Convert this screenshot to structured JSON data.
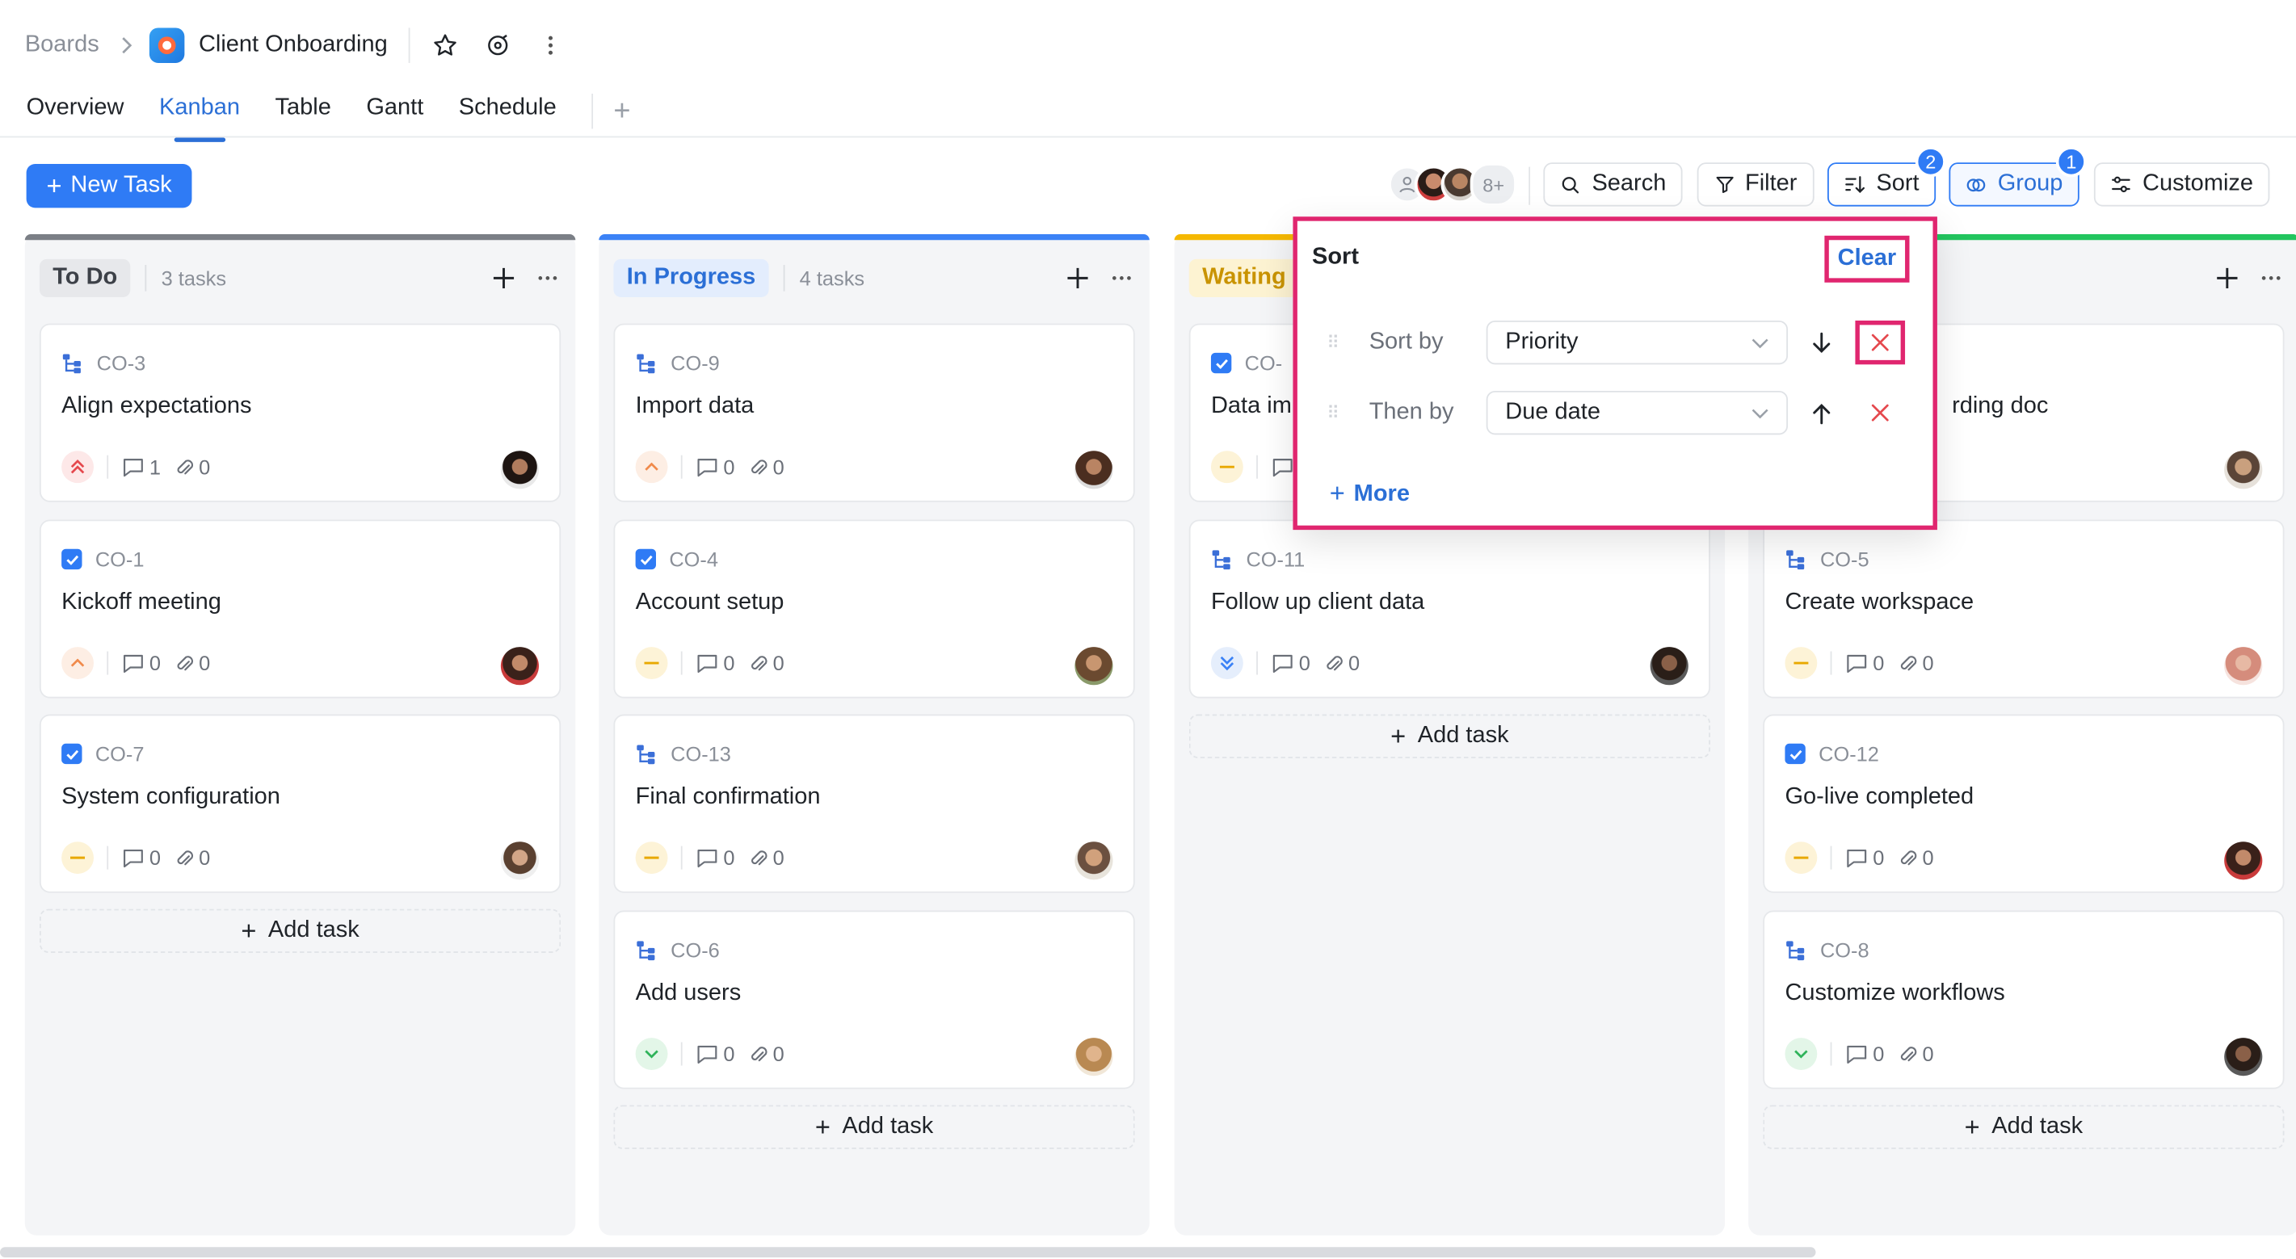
{
  "breadcrumb": {
    "root": "Boards",
    "board_title": "Client Onboarding"
  },
  "tabs": [
    "Overview",
    "Kanban",
    "Table",
    "Gantt",
    "Schedule"
  ],
  "active_tab": "Kanban",
  "toolbar": {
    "new_task": "New Task",
    "members_more": "8+",
    "search": "Search",
    "filter": "Filter",
    "sort": "Sort",
    "sort_badge": "2",
    "group": "Group",
    "group_badge": "1",
    "customize": "Customize"
  },
  "colors": {
    "accent": "#2f7bf5",
    "highlight": "#e0266f",
    "todo": "#7b7f86",
    "in_progress": "#3b82f6",
    "waiting": "#f5b800",
    "done": "#22c55e"
  },
  "columns": [
    {
      "name": "To Do",
      "count": "3 tasks",
      "add_task": "Add task",
      "cards": [
        {
          "id": "CO-3",
          "title": "Align expectations",
          "type": "subtask",
          "priority": "urgent",
          "comments": "1",
          "attachments": "0",
          "avatar": "avatar-woman-dark-hair"
        },
        {
          "id": "CO-1",
          "title": "Kickoff meeting",
          "type": "task",
          "priority": "high",
          "comments": "0",
          "attachments": "0",
          "avatar": "avatar-woman-red-top"
        },
        {
          "id": "CO-7",
          "title": "System configuration",
          "type": "task",
          "priority": "medium",
          "comments": "0",
          "attachments": "0",
          "avatar": "avatar-man-light"
        }
      ]
    },
    {
      "name": "In Progress",
      "count": "4 tasks",
      "add_task": "Add task",
      "cards": [
        {
          "id": "CO-9",
          "title": "Import data",
          "type": "subtask",
          "priority": "high",
          "comments": "0",
          "attachments": "0",
          "avatar": "avatar-woman-curly"
        },
        {
          "id": "CO-4",
          "title": "Account setup",
          "type": "task",
          "priority": "medium",
          "comments": "0",
          "attachments": "0",
          "avatar": "avatar-woman-glasses"
        },
        {
          "id": "CO-13",
          "title": "Final confirmation",
          "type": "subtask",
          "priority": "medium",
          "comments": "0",
          "attachments": "0",
          "avatar": "avatar-man-smiling"
        },
        {
          "id": "CO-6",
          "title": "Add users",
          "type": "subtask",
          "priority": "low",
          "comments": "0",
          "attachments": "0",
          "avatar": "avatar-woman-blonde"
        }
      ]
    },
    {
      "name": "Waiting",
      "count": "",
      "add_task": "Add task",
      "cards": [
        {
          "id": "CO-",
          "title": "Data im",
          "type": "task",
          "priority": "medium",
          "comments": "",
          "attachments": "",
          "avatar": ""
        },
        {
          "id": "CO-11",
          "title": "Follow up client data",
          "type": "subtask",
          "priority": "lowest",
          "comments": "0",
          "attachments": "0",
          "avatar": "avatar-man-dark"
        }
      ]
    },
    {
      "name": "",
      "count": "",
      "add_task": "Add task",
      "cards": [
        {
          "id": "",
          "title": "rding doc",
          "type": "",
          "priority": "",
          "comments": "",
          "attachments": "",
          "avatar": "avatar-man-beard"
        },
        {
          "id": "CO-5",
          "title": "Create workspace",
          "type": "subtask",
          "priority": "medium",
          "comments": "0",
          "attachments": "0",
          "avatar": "avatar-woman-pink"
        },
        {
          "id": "CO-12",
          "title": "Go-live completed",
          "type": "task",
          "priority": "medium",
          "comments": "0",
          "attachments": "0",
          "avatar": "avatar-woman-red-top"
        },
        {
          "id": "CO-8",
          "title": "Customize workflows",
          "type": "subtask",
          "priority": "low",
          "comments": "0",
          "attachments": "0",
          "avatar": "avatar-man-dark"
        }
      ]
    }
  ],
  "sort_popup": {
    "title": "Sort",
    "clear": "Clear",
    "rows": [
      {
        "label": "Sort by",
        "field": "Priority",
        "direction": "descending"
      },
      {
        "label": "Then by",
        "field": "Due date",
        "direction": "ascending"
      }
    ],
    "more": "More"
  }
}
